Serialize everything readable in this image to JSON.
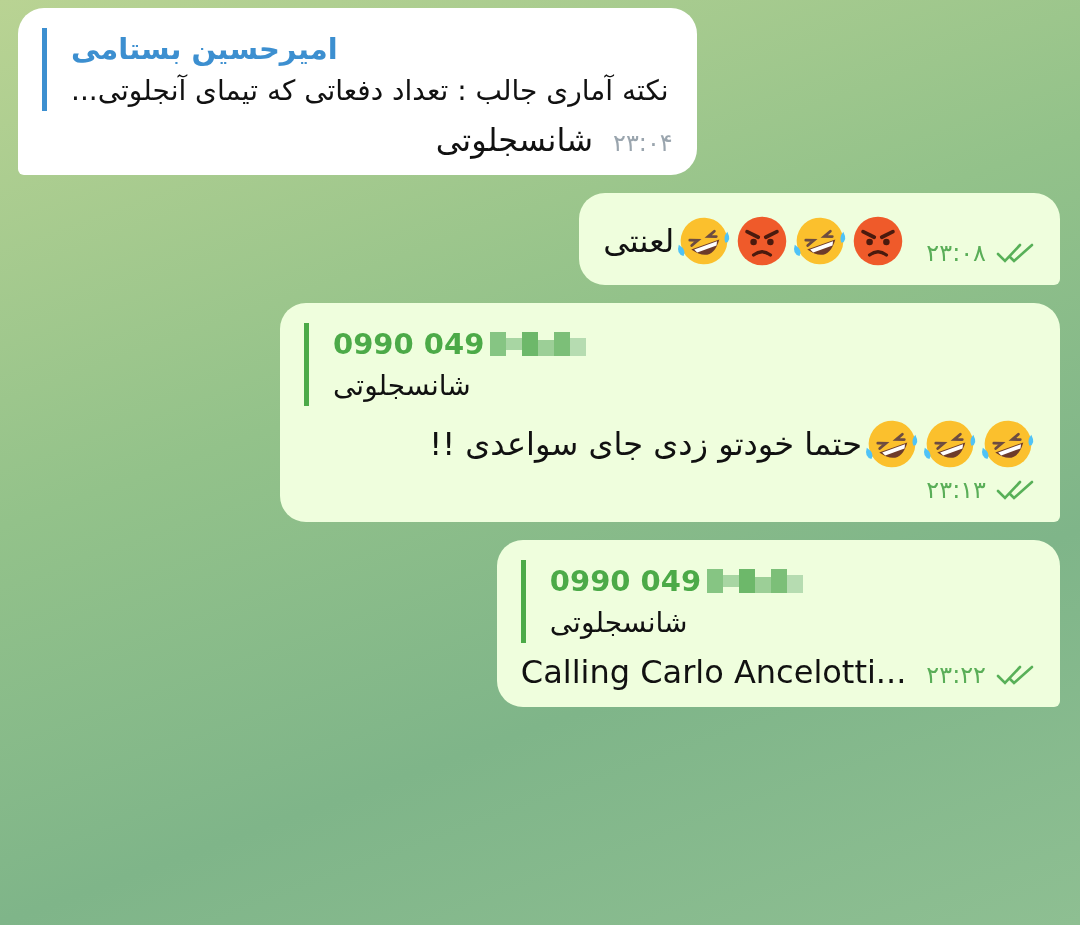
{
  "messages": [
    {
      "kind": "incoming",
      "reply": {
        "name": "امیرحسین بستامی",
        "name_blurred": false,
        "color": "#3c8fd0",
        "text": "نکته آماری جالب : تعداد دفعاتی که تیمای آنجلوتی..."
      },
      "text": "شانسجلوتی",
      "time": "۲۳:۰۴"
    },
    {
      "kind": "outgoing",
      "text": "لعنتی",
      "emojis": [
        {
          "kind": "laughing"
        },
        {
          "kind": "angry"
        },
        {
          "kind": "laughing"
        },
        {
          "kind": "angry"
        }
      ],
      "time": "۲۳:۰۸",
      "read": true
    },
    {
      "kind": "outgoing",
      "reply": {
        "name": "0990 049",
        "name_blurred": true,
        "color": "#4caa48",
        "text": "شانسجلوتی"
      },
      "text": "حتما خودتو زدی جای سواعدی !!",
      "emojis": [
        {
          "kind": "laughing"
        },
        {
          "kind": "laughing"
        },
        {
          "kind": "laughing"
        }
      ],
      "time": "۲۳:۱۳",
      "read": true
    },
    {
      "kind": "outgoing",
      "reply": {
        "name": "0990 049",
        "name_blurred": true,
        "color": "#4caa48",
        "text": "شانسجلوتی"
      },
      "text": "Calling Carlo Ancelotti...",
      "time": "۲۳:۲۲",
      "read": true
    }
  ]
}
